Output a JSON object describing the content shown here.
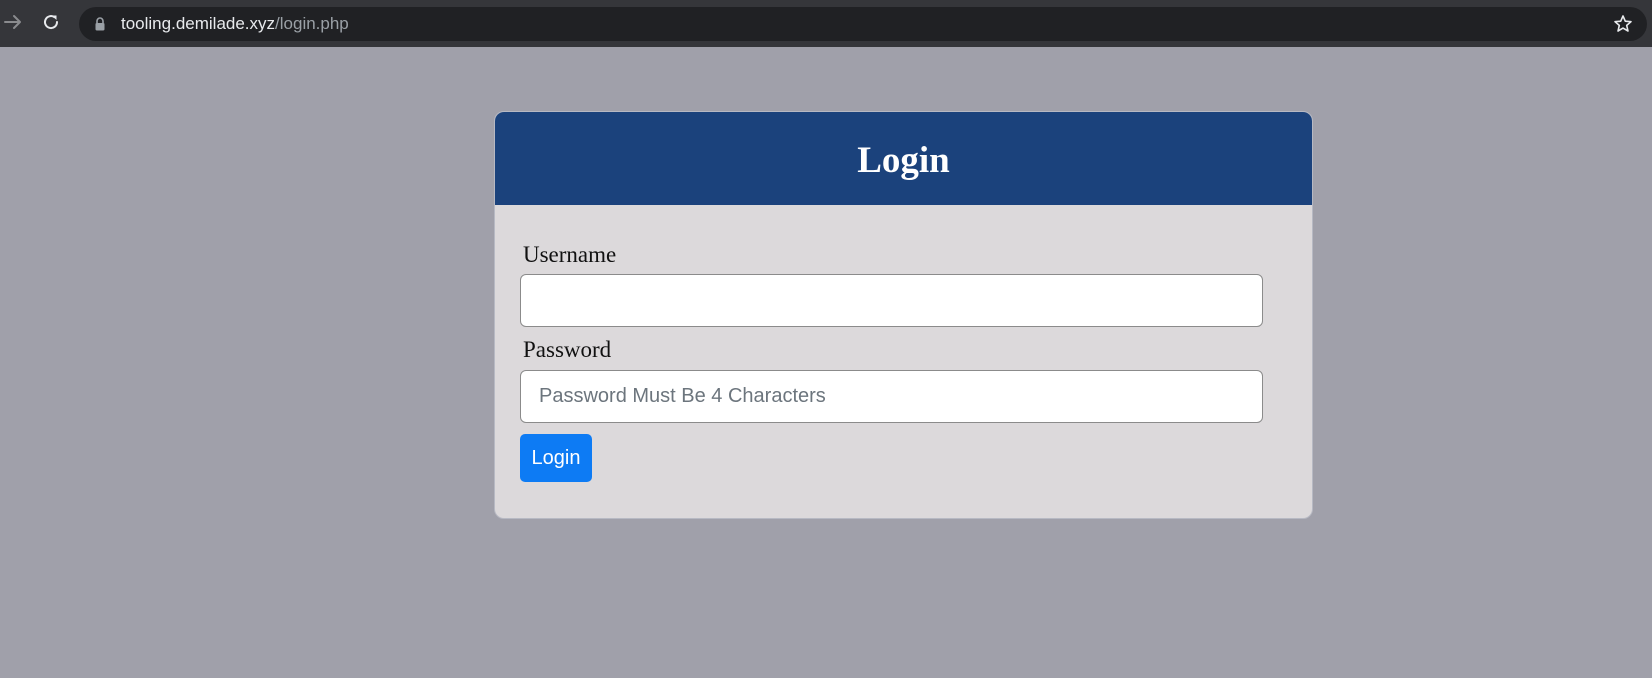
{
  "browser": {
    "url_host": "tooling.demilade.xyz",
    "url_path": "/login.php",
    "icons": {
      "forward": "arrow-forward-icon",
      "reload": "reload-icon",
      "lock": "lock-icon",
      "bookmark": "star-icon"
    }
  },
  "login_card": {
    "title": "Login",
    "username_label": "Username",
    "username_value": "",
    "password_label": "Password",
    "password_placeholder": "Password Must Be 4 Characters",
    "submit_label": "Login"
  },
  "colors": {
    "page_background": "#a0a0aa",
    "header_background": "#1b427c",
    "card_background": "#dcd9db",
    "button_background": "#0d7bf4"
  }
}
